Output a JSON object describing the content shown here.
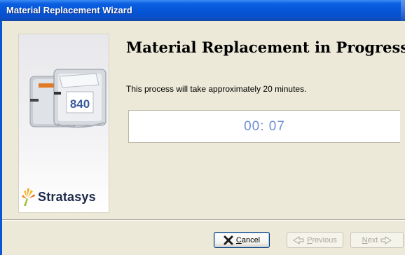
{
  "window": {
    "title": "Material Replacement Wizard"
  },
  "main": {
    "heading": "Material Replacement in Progress",
    "description": "This process will take approximately 20 minutes.",
    "timer": "00: 07"
  },
  "sidebar": {
    "logo_text": "Stratasys",
    "cartridge_label": "840"
  },
  "buttons": {
    "cancel": {
      "mnemonic": "C",
      "rest": "ancel"
    },
    "previous": {
      "mnemonic": "P",
      "rest": "revious"
    },
    "next": {
      "mnemonic": "N",
      "rest": "ext"
    }
  },
  "icons": {
    "cancel": "x-icon",
    "previous": "arrow-left-icon",
    "next": "arrow-right-icon",
    "logo": "stratasys-logo-icon"
  },
  "colors": {
    "titlebar": "#0556d8",
    "timer_text": "#6e8fd6",
    "cancel_x": "#1a1a1a",
    "logo_orange": "#f5a21b",
    "logo_text": "#1e2a4a"
  }
}
